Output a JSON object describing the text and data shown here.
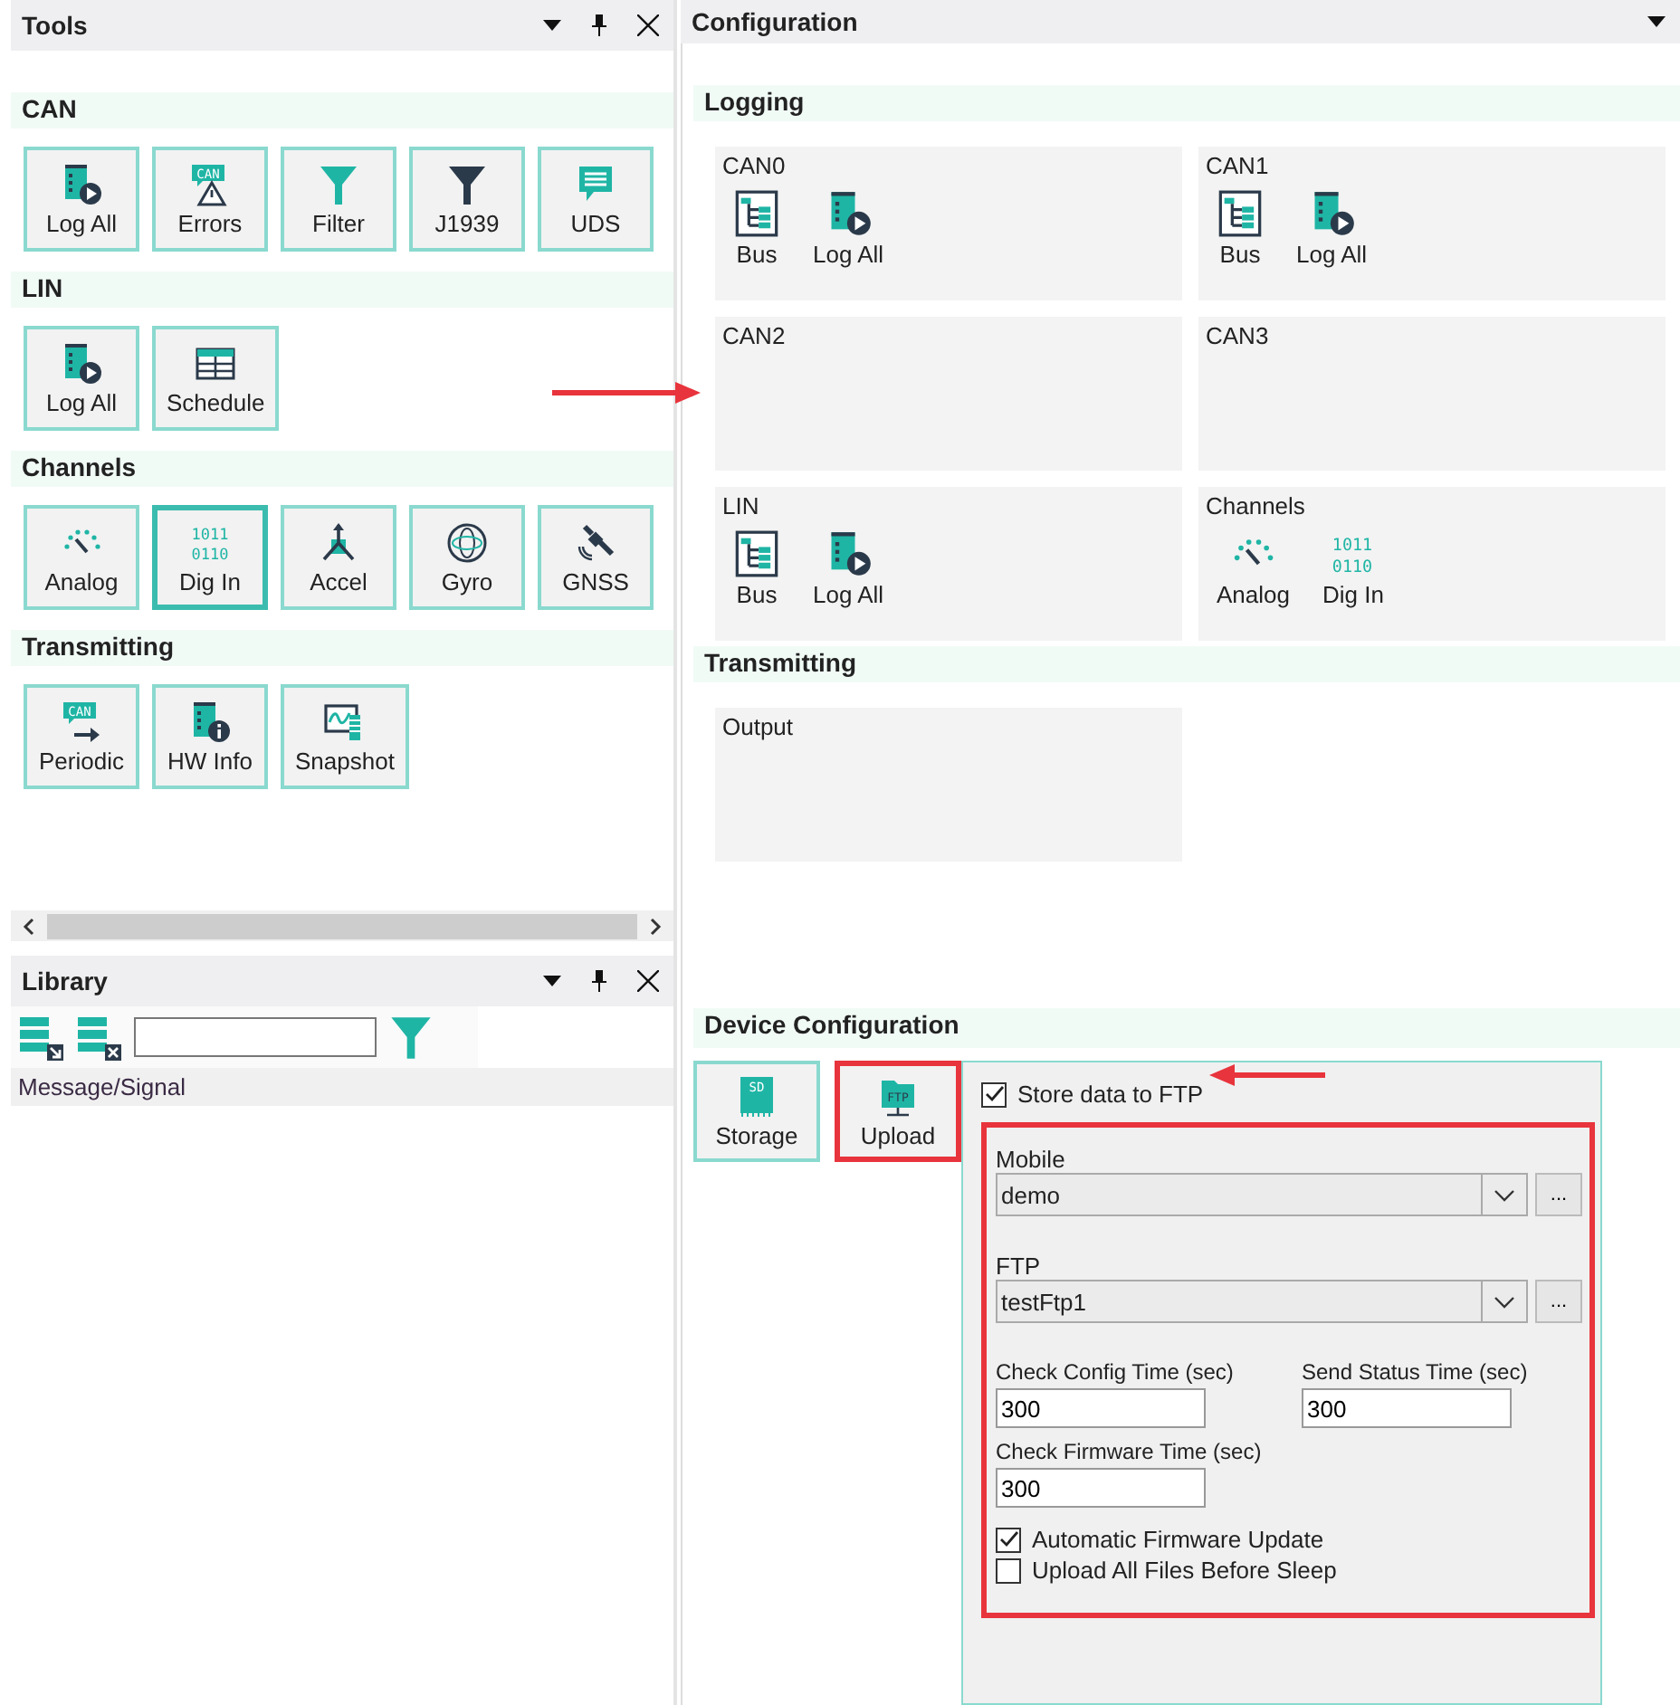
{
  "tools": {
    "title": "Tools",
    "sections": [
      {
        "title": "CAN",
        "items": [
          {
            "label": "Log All",
            "kind": "log",
            "selected": false
          },
          {
            "label": "Errors",
            "kind": "can-warning",
            "icon_text": [
              "CAN"
            ],
            "selected": false
          },
          {
            "label": "Filter",
            "kind": "filter",
            "selected": false
          },
          {
            "label": "J1939",
            "kind": "filter-dark",
            "selected": false
          },
          {
            "label": "UDS",
            "kind": "chat",
            "selected": false
          }
        ]
      },
      {
        "title": "LIN",
        "items": [
          {
            "label": "Log All",
            "kind": "log",
            "selected": false
          },
          {
            "label": "Schedule",
            "kind": "table",
            "selected": false
          }
        ]
      },
      {
        "title": "Channels",
        "items": [
          {
            "label": "Analog",
            "kind": "gauge",
            "selected": false
          },
          {
            "label": "Dig In",
            "kind": "binary",
            "icon_text": [
              "1011",
              "0110"
            ],
            "selected": true
          },
          {
            "label": "Accel",
            "kind": "axes",
            "selected": false
          },
          {
            "label": "Gyro",
            "kind": "gyro",
            "selected": false
          },
          {
            "label": "GNSS",
            "kind": "satellite",
            "selected": false
          }
        ]
      },
      {
        "title": "Transmitting",
        "items": [
          {
            "label": "Periodic",
            "kind": "can-arrow",
            "icon_text": [
              "CAN"
            ],
            "selected": false
          },
          {
            "label": "HW Info",
            "kind": "doc-info",
            "selected": false
          },
          {
            "label": "Snapshot",
            "kind": "snapshot",
            "selected": false
          }
        ]
      }
    ]
  },
  "library": {
    "title": "Library",
    "columns": [
      "Message/Signal"
    ]
  },
  "configuration": {
    "title": "Configuration",
    "sections": [
      {
        "title": "Logging",
        "groups": [
          {
            "title": "CAN0",
            "items": [
              {
                "label": "Bus",
                "kind": "bus"
              },
              {
                "label": "Log All",
                "kind": "log"
              }
            ]
          },
          {
            "title": "CAN1",
            "items": [
              {
                "label": "Bus",
                "kind": "bus"
              },
              {
                "label": "Log All",
                "kind": "log"
              }
            ]
          },
          {
            "title": "CAN2"
          },
          {
            "title": "CAN3"
          },
          {
            "title": "LIN",
            "items": [
              {
                "label": "Bus",
                "kind": "bus"
              },
              {
                "label": "Log All",
                "kind": "log"
              }
            ]
          },
          {
            "title": "Channels",
            "items": [
              {
                "label": "Analog",
                "kind": "gauge"
              },
              {
                "label": "Dig In",
                "kind": "binary",
                "icon_text": [
                  "1011",
                  "0110"
                ]
              }
            ]
          }
        ]
      },
      {
        "title": "Transmitting",
        "groups": [
          {
            "title": "Output"
          }
        ]
      }
    ]
  },
  "device_configuration": {
    "title": "Device Configuration",
    "modes": [
      {
        "label": "Storage",
        "kind": "sd",
        "icon_text": [
          "SD"
        ],
        "highlighted": false
      },
      {
        "label": "Upload",
        "kind": "ftp",
        "icon_text": [
          "FTP"
        ],
        "highlighted": true
      }
    ],
    "store_to_ftp": {
      "label": "Store data to FTP",
      "checked": true
    },
    "settings": {
      "highlighted": true,
      "dropdowns": [
        {
          "label": "Mobile",
          "value": "demo",
          "browse": "..."
        },
        {
          "label": "FTP",
          "value": "testFtp1",
          "browse": "..."
        }
      ],
      "fields": [
        {
          "label": "Check Config Time (sec)",
          "value": "300"
        },
        {
          "label": "Send Status Time (sec)",
          "value": "300"
        },
        {
          "label": "Check Firmware Time (sec)",
          "value": "300"
        }
      ],
      "options": [
        {
          "label": "Automatic Firmware Update",
          "checked": true
        },
        {
          "label": "Upload All Files Before Sleep",
          "checked": false
        }
      ]
    }
  }
}
